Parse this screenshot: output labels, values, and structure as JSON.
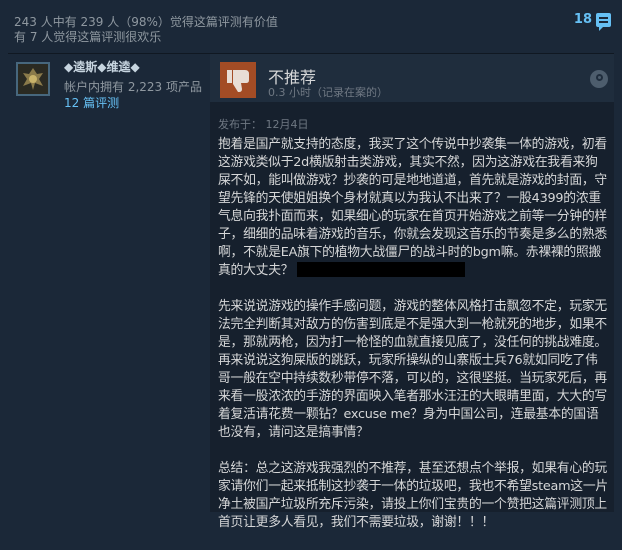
{
  "helpful": {
    "line1": "243 人中有 239 人（98%）觉得这篇评测有价值",
    "line2": "有 7 人觉得这篇评测很欢乐"
  },
  "comments": {
    "count": "18",
    "icon": "comment-icon"
  },
  "author": {
    "name": "◆逵斯◆维逵◆",
    "products": "帐户内拥有 2,223 项产品",
    "reviews": "12 篇评测",
    "avatar_icon": "avatar"
  },
  "recommendation": {
    "label": "不推荐",
    "hours": "0.3 小时（记录在案的）",
    "thumb_icon": "thumbs-down-icon",
    "platform_icon": "steam-icon",
    "thumb_color": "#a34c25"
  },
  "posted": "发布于：  12月4日",
  "review": {
    "p1": "抱着是国产就支持的态度，我买了这个传说中抄袭集一体的游戏，初看这游戏类似于2d横版射击类游戏，其实不然，因为这游戏在我看来狗屎不如，能叫做游戏？抄袭的可是地地道道，首先就是游戏的封面，守望先锋的天使姐姐换个身材就真以为我认不出来了？一股4399的浓重气息向我扑面而来，如果细心的玩家在首页开始游戏之前等一分钟的样子，细细的品味着游戏的音乐，你就会发现这音乐的节奏是多么的熟悉啊，不就是EA旗下的植物大战僵尸的战斗时的bgm嘛。赤裸裸的照搬真的大丈夫？",
    "p2": "先来说说游戏的操作手感问题，游戏的整体风格打击飘忽不定，玩家无法完全判断其对敌方的伤害到底是不是强大到一枪就死的地步，如果不是，那就两枪，因为打一枪怪的血就直接见底了，没任何的挑战难度。再来说说这狗屎版的跳跃，玩家所操纵的山寨版士兵76就如同吃了伟哥一般在空中持续数秒带停不落，可以的，这很坚挺。当玩家死后，再来看一股浓浓的手游的界面映入笔者那水汪汪的大眼睛里面，大大的写着复活请花费一颗钻？excuse me？身为中国公司，连最基本的国语也没有，请问这是搞事情？",
    "p3": "总结：总之这游戏我强烈的不推荐，甚至还想点个举报，如果有心的玩家请你们一起来抵制这抄袭于一体的垃圾吧，我也不希望steam这一片净土被国产垃圾所充斥污染，请投上你们宝贵的一个赞把这篇评测顶上首页让更多人看见，我们不需要垃圾，谢谢！！！"
  },
  "colors": {
    "background": "#1b2838",
    "link": "#66c0f4",
    "text": "#d6d7d8"
  }
}
